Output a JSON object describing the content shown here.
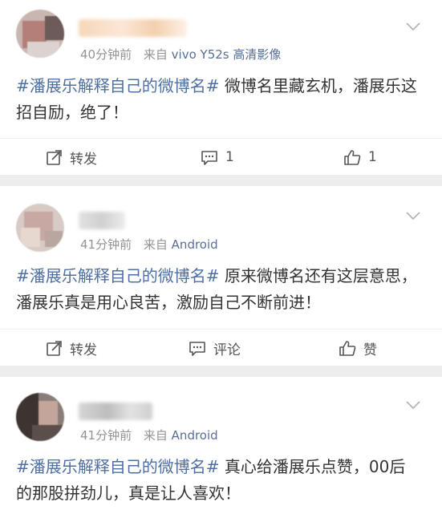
{
  "posts": [
    {
      "time": "40分钟前",
      "source_prefix": "来自",
      "source": "vivo Y52s 高清影像",
      "hashtag": "#潘展乐解释自己的微博名#",
      "text": "微博名里藏玄机，潘展乐这招自励，绝了！",
      "actions": {
        "repost": "转发",
        "comment": "1",
        "like": "1"
      }
    },
    {
      "time": "41分钟前",
      "source_prefix": "来自",
      "source": "Android",
      "hashtag": "#潘展乐解释自己的微博名#",
      "text": "原来微博名还有这层意思，潘展乐真是用心良苦，激励自己不断前进！",
      "actions": {
        "repost": "转发",
        "comment": "评论",
        "like": "赞"
      }
    },
    {
      "time": "41分钟前",
      "source_prefix": "来自",
      "source": "Android",
      "hashtag": "#潘展乐解释自己的微博名#",
      "text": "真心给潘展乐点赞，00后的那股拼劲儿，真是让人喜欢！"
    }
  ],
  "colors": {
    "hashtag": "#4e6fa3",
    "source": "#5b6e93",
    "meta": "#939393",
    "gap": "#ededed"
  },
  "icons": [
    "chevron-down-icon",
    "repost-icon",
    "comment-icon",
    "like-icon"
  ]
}
